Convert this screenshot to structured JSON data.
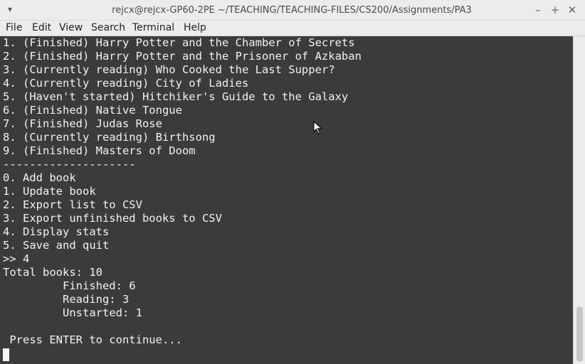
{
  "window": {
    "title": "rejcx@rejcx-GP60-2PE ~/TEACHING/TEACHING-FILES/CS200/Assignments/PA3",
    "menu_glyph": "▾",
    "minimize_glyph": "–",
    "maximize_glyph": "+",
    "close_glyph": "✕"
  },
  "menubar": {
    "items": [
      "File",
      "Edit",
      "View",
      "Search",
      "Terminal",
      "Help"
    ]
  },
  "terminal": {
    "lines": [
      "1. (Finished) Harry Potter and the Chamber of Secrets",
      "2. (Finished) Harry Potter and the Prisoner of Azkaban",
      "3. (Currently reading) Who Cooked the Last Supper?",
      "4. (Currently reading) City of Ladies",
      "5. (Haven't started) Hitchiker's Guide to the Galaxy",
      "6. (Finished) Native Tongue",
      "7. (Finished) Judas Rose",
      "8. (Currently reading) Birthsong",
      "9. (Finished) Masters of Doom",
      "--------------------",
      "0. Add book",
      "1. Update book",
      "2. Export list to CSV",
      "3. Export unfinished books to CSV",
      "4. Display stats",
      "5. Save and quit",
      ">> 4",
      "Total books: 10",
      "         Finished: 6",
      "         Reading: 3",
      "         Unstarted: 1",
      "",
      " Press ENTER to continue..."
    ]
  }
}
